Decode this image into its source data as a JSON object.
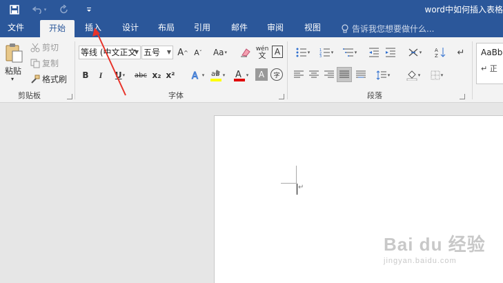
{
  "window": {
    "title": "word中如何插入表格"
  },
  "qat": {
    "save_icon": "save-icon",
    "undo_icon": "undo-icon",
    "redo_icon": "redo-icon",
    "customize_icon": "customize-qat-icon"
  },
  "tabs": [
    {
      "label": "文件"
    },
    {
      "label": "开始",
      "active": true
    },
    {
      "label": "插入"
    },
    {
      "label": "设计"
    },
    {
      "label": "布局"
    },
    {
      "label": "引用"
    },
    {
      "label": "邮件"
    },
    {
      "label": "审阅"
    },
    {
      "label": "视图"
    }
  ],
  "tell_me": {
    "placeholder": "告诉我您想要做什么..."
  },
  "clipboard": {
    "group_label": "剪贴板",
    "paste_label": "粘贴",
    "cut_label": "剪切",
    "copy_label": "复制",
    "format_painter_label": "格式刷"
  },
  "font": {
    "group_label": "字体",
    "font_name": "等线 (中文正文",
    "font_size": "五号",
    "change_case_label": "Aa",
    "phonetic_label": "wén",
    "bold": "B",
    "italic": "I",
    "underline": "U",
    "strikethrough": "abc",
    "subscript": "x₂",
    "superscript": "x²",
    "char_shading": "A",
    "enclose": "字",
    "highlight_color": "#ffff00",
    "font_color": "#e00000"
  },
  "paragraph": {
    "group_label": "段落"
  },
  "styles": {
    "preview": "AaBb",
    "name": "↵ 正"
  },
  "document": {
    "paragraph_mark": "↵"
  },
  "watermark": {
    "brand": "Bai du 经验",
    "url": "jingyan.baidu.com"
  },
  "annotation": {
    "arrow_color": "#e8332a"
  }
}
